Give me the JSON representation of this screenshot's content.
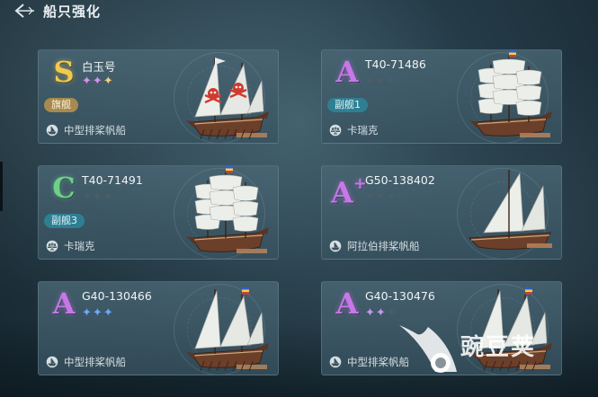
{
  "header": {
    "title": "船只强化"
  },
  "cards": [
    {
      "grade": "S",
      "grade_color": "#f2c94c",
      "name": "白玉号",
      "stars": "✦✦✦",
      "star_colors": [
        "#d891ef",
        "#d891ef",
        "#f4d07c"
      ],
      "badge": "旗舰",
      "badge_kind": "flag",
      "type_icon": "ship-type-icon",
      "type_label": "中型排桨帆船"
    },
    {
      "grade": "A",
      "grade_color": "#c678e8",
      "name": "T40-71486",
      "stars": "✦✦✦",
      "star_colors": [
        "#4d5d66",
        "#4d5d66",
        "#4d5d66"
      ],
      "badge": "副舰1",
      "badge_kind": "vice",
      "type_icon": "scale-icon",
      "type_label": "卡瑞克"
    },
    {
      "grade": "C",
      "grade_color": "#6fd08a",
      "name": "T40-71491",
      "stars": "✦✦✦",
      "star_colors": [
        "#4d5d66",
        "#4d5d66",
        "#4d5d66"
      ],
      "badge": "副舰3",
      "badge_kind": "vice",
      "type_icon": "scale-icon",
      "type_label": "卡瑞克"
    },
    {
      "grade": "A",
      "grade_plus": "+",
      "grade_color": "#c678e8",
      "name": "G50-138402",
      "stars": "✦✦✦",
      "star_colors": [
        "#4d5d66",
        "#4d5d66",
        "#4d5d66"
      ],
      "badge": "",
      "badge_kind": "",
      "type_icon": "ship-type-icon",
      "type_label": "阿拉伯排桨帆船"
    },
    {
      "grade": "A",
      "grade_color": "#c678e8",
      "name": "G40-130466",
      "stars": "✦✦✦",
      "star_colors": [
        "#6aa8ff",
        "#6aa8ff",
        "#6aa8ff"
      ],
      "badge": "",
      "badge_kind": "",
      "type_icon": "ship-type-icon",
      "type_label": "中型排桨帆船"
    },
    {
      "grade": "A",
      "grade_color": "#c678e8",
      "name": "G40-130476",
      "stars": "✦✦✦",
      "star_colors": [
        "#c596ef",
        "#c596ef",
        "#4d5d66"
      ],
      "badge": "",
      "badge_kind": "",
      "type_icon": "ship-type-icon",
      "type_label": "中型排桨帆船"
    }
  ],
  "watermark": {
    "text": "豌豆荚"
  }
}
